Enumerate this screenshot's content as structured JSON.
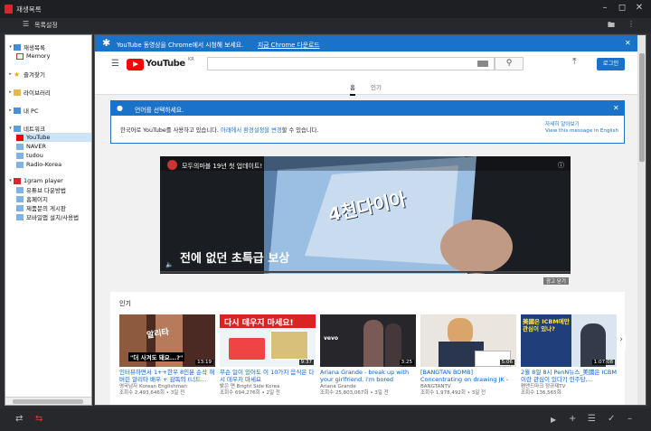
{
  "window": {
    "title": "재생목록"
  },
  "toolbar": {
    "label": "목록설정"
  },
  "sidebar": {
    "items": [
      {
        "label": "재생목록"
      },
      {
        "label": "Memory"
      },
      {
        "label": "즐겨찾기"
      },
      {
        "label": "라이브러리"
      },
      {
        "label": "내 PC"
      },
      {
        "label": "네트워크"
      },
      {
        "label": "YouTube"
      },
      {
        "label": "NAVER"
      },
      {
        "label": "tudou"
      },
      {
        "label": "Radio-Korea"
      },
      {
        "label": "1gram player"
      },
      {
        "label": "유튜브 다운방법"
      },
      {
        "label": "홈페이지"
      },
      {
        "label": "제품문의 게시판"
      },
      {
        "label": "모바일앱 설치/사용법"
      }
    ]
  },
  "banner": {
    "text": "YouTube 동영상을 Chrome에서 시청해 보세요.",
    "link": "지금 Chrome 다운로드"
  },
  "youtube": {
    "logo": "YouTube",
    "region": "KR",
    "login": "로그인",
    "tabs": [
      "홈",
      "인기"
    ]
  },
  "notice": {
    "title": "언어를 선택하세요.",
    "body_pre": "한국어로 YouTube를 사용하고 있습니다.",
    "body_link": "아래에서 환경설정을 변경",
    "body_post": "할 수 있습니다.",
    "more": "자세히 알아보기",
    "english": "View this message in English"
  },
  "ad": {
    "channel": "모두의마블 19년 첫 업데이트!",
    "headline": "전에 없던 초특급 보상",
    "big": "4천다이아",
    "hide": "광고 닫기"
  },
  "shelf": {
    "title": "인기",
    "videos": [
      {
        "title": "인터뷰하면서 1++한우 8인분 순삭 해버린 알리타 배우 + 감독의 (너드...",
        "channel": "영국남자 Korean Englishman",
        "meta": "조회수 2,493,646회 • 3일 전",
        "duration": "13:19",
        "caption": "\"더 사겨도 돼요...?\"",
        "overlay": "알리타"
      },
      {
        "title": "무슨 일이 있어도 이 10가지 음식은 다시 데우지 마세요",
        "channel": "밝은 면 Bright Side Korea",
        "meta": "조회수 694,276회 • 2일 전",
        "duration": "9:37",
        "overlay": "다시 데우지 마세요!"
      },
      {
        "title": "Ariana Grande - break up with your girlfriend, i'm bored",
        "channel": "Ariana Grande",
        "meta": "조회수 25,803,067회 • 3일 전",
        "duration": "3:25",
        "overlay": "vevo"
      },
      {
        "title": "[BANGTAN BOMB] Concentrating on drawing JK - BTS (방탄소년단...",
        "channel": "BANGTANTV",
        "meta": "조회수 1,978,492회 • 3일 전",
        "duration": "5:06"
      },
      {
        "title": "2월 8일 8시 PenN뉴스_美國은 ICBM이란 관심이 있다?| 인주당,...",
        "channel": "펜앤드마크 정규재TV",
        "meta": "조회수 136,565회",
        "duration": "1:07:08",
        "overlay": "美國은 ICBM에만 관심이 있나?"
      }
    ]
  },
  "colors": {
    "accent": "#1a73c8",
    "youtube_red": "#ff0000",
    "side_select": "#cde3f7"
  }
}
